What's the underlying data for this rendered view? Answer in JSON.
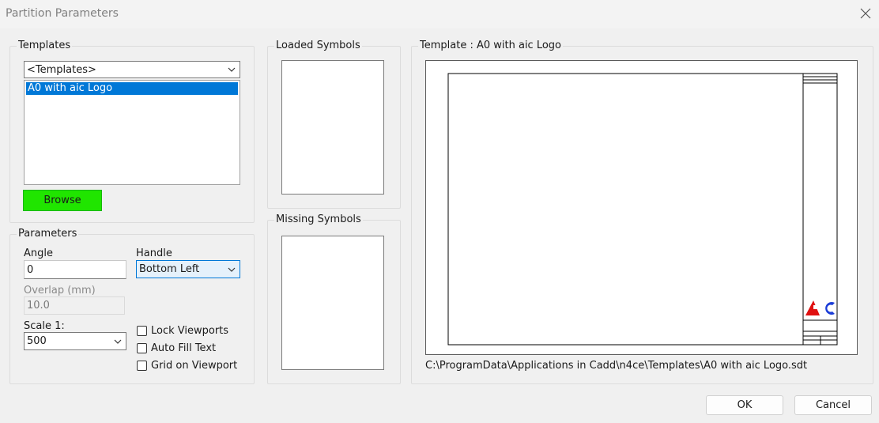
{
  "window": {
    "title": "Partition Parameters"
  },
  "templates": {
    "group_label": "Templates",
    "dropdown_value": "<Templates>",
    "list_items": [
      "A0 with aic Logo"
    ],
    "browse_label": "Browse",
    "browse_color": "#20e500"
  },
  "loaded_symbols": {
    "group_label": "Loaded Symbols"
  },
  "missing_symbols": {
    "group_label": "Missing Symbols"
  },
  "template_preview": {
    "group_label": "Template : A0 with aic Logo",
    "path": "C:\\ProgramData\\Applications in Cadd\\n4ce\\Templates\\A0 with aic Logo.sdt",
    "logo_text": "aic"
  },
  "parameters": {
    "group_label": "Parameters",
    "angle_label": "Angle",
    "angle_value": "0",
    "handle_label": "Handle",
    "handle_value": "Bottom Left",
    "overlap_label": "Overlap (mm)",
    "overlap_value": "10.0",
    "scale_label": "Scale 1:",
    "scale_value": "500",
    "checkboxes": {
      "lock_viewports": {
        "label": "Lock Viewports",
        "checked": false
      },
      "auto_fill_text": {
        "label": "Auto Fill Text",
        "checked": false
      },
      "grid_on_viewport": {
        "label": "Grid on Viewport",
        "checked": false
      }
    }
  },
  "buttons": {
    "ok": "OK",
    "cancel": "Cancel"
  },
  "colors": {
    "selection": "#0078d7",
    "logo_red": "#e01010",
    "logo_blue": "#1a3cd8"
  }
}
